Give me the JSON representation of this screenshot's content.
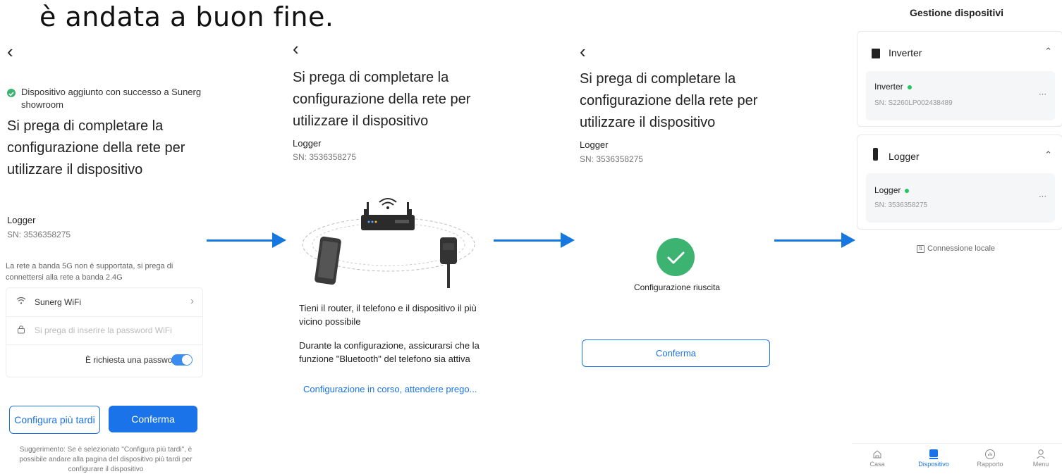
{
  "heading": "è andata a buon fine.",
  "arrow_color": "#1677e0",
  "accent_color": "#1a73e8",
  "success_color": "#3cb371",
  "screen1": {
    "success_text": "Dispositivo aggiunto con successo a Sunerg showroom",
    "title": "Si prega di completare la configurazione della rete per utilizzare il dispositivo",
    "device_name": "Logger",
    "sn": "SN: 3536358275",
    "band_note": "La rete a banda 5G non è supportata, si prega di connettersi alla rete a banda 2.4G",
    "wifi_name": "Sunerg WiFi",
    "password_placeholder": "Si prega di inserire la password WiFi",
    "password_required_label": "È richiesta una password?",
    "password_required": true,
    "later_button": "Configura più tardi",
    "confirm_button": "Conferma",
    "hint": "Suggerimento: Se è selezionato \"Configura più tardi\", è possibile andare alla pagina del dispositivo più tardi per configurare il dispositivo"
  },
  "screen2": {
    "title": "Si prega di completare la configurazione della rete per utilizzare il dispositivo",
    "device_name": "Logger",
    "sn": "SN: 3536358275",
    "tip1": "Tieni il router, il telefono e il dispositivo il più vicino possibile",
    "tip2": "Durante la configurazione, assicurarsi che la funzione \"Bluetooth\" del telefono sia attiva",
    "progress": "Configurazione in corso, attendere prego..."
  },
  "screen3": {
    "title": "Si prega di completare la configurazione della rete per utilizzare il dispositivo",
    "device_name": "Logger",
    "sn": "SN: 3536358275",
    "status": "Configurazione riuscita",
    "confirm_button": "Conferma"
  },
  "screen4": {
    "title": "Gestione dispositivi",
    "groups": [
      {
        "name": "Inverter",
        "device": "Inverter",
        "sn": "SN: S2260LP002438489",
        "online": true,
        "icon": "inverter-icon"
      },
      {
        "name": "Logger",
        "device": "Logger",
        "sn": "SN: 3536358275",
        "online": true,
        "icon": "logger-icon"
      }
    ],
    "local_connection": "Connessione locale",
    "nav": [
      {
        "label": "Casa",
        "icon": "home-icon"
      },
      {
        "label": "Dispositivo",
        "icon": "device-icon",
        "active": true
      },
      {
        "label": "Rapporto",
        "icon": "report-icon"
      },
      {
        "label": "Menu",
        "icon": "user-icon"
      }
    ]
  }
}
